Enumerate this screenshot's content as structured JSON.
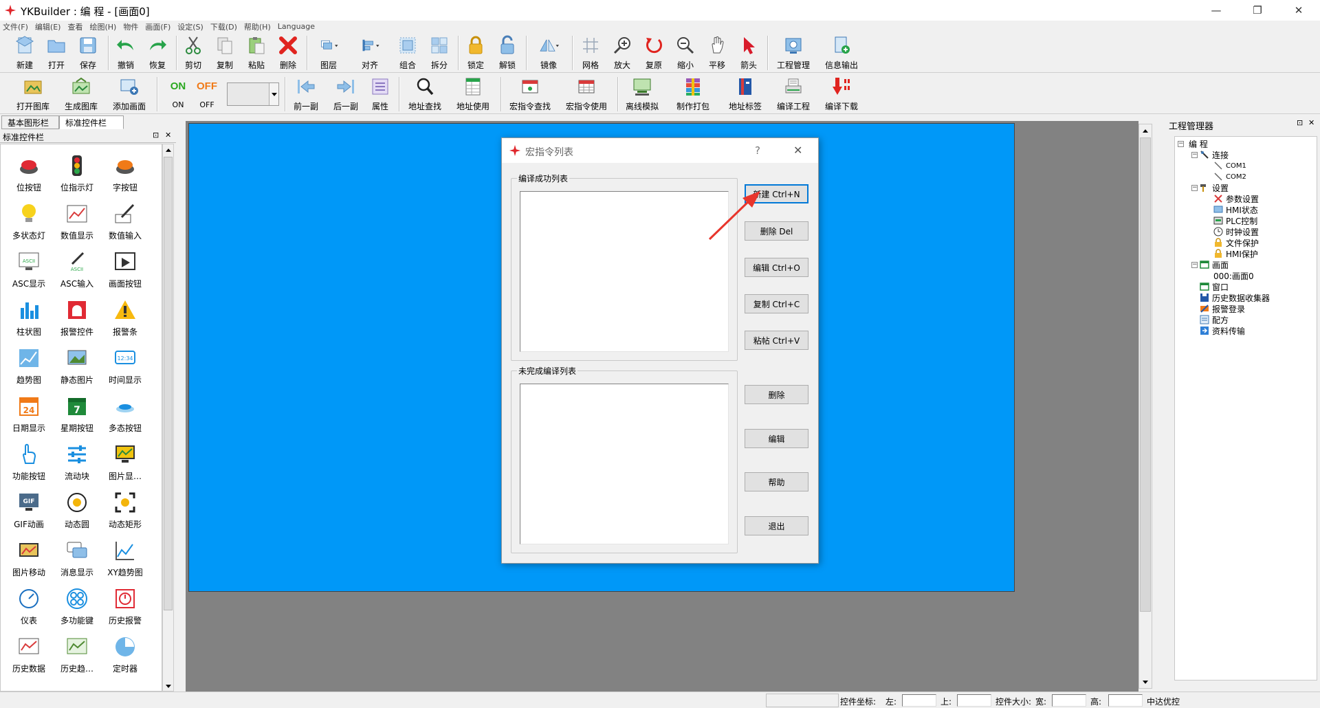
{
  "window": {
    "title": "YKBuilder : 编 程 - [画面0]",
    "buttons": {
      "minimize": "—",
      "restore": "❐",
      "close": "✕"
    }
  },
  "menu": [
    "文件(F)",
    "编辑(E)",
    "查看",
    "绘图(H)",
    "物件",
    "画面(F)",
    "设定(S)",
    "下载(D)",
    "帮助(H)",
    "Language"
  ],
  "toolbar1": [
    "新建",
    "打开",
    "保存",
    "撤销",
    "恢复",
    "剪切",
    "复制",
    "粘贴",
    "删除",
    "图层",
    "对齐",
    "组合",
    "拆分",
    "锁定",
    "解锁",
    "镜像",
    "网格",
    "放大",
    "复原",
    "缩小",
    "平移",
    "箭头",
    "工程管理",
    "信息输出"
  ],
  "toolbar2": {
    "items": [
      "打开图库",
      "生成图库",
      "添加画面",
      "ON",
      "OFF",
      "前一副",
      "后一副",
      "属性",
      "地址查找",
      "地址使用",
      "宏指令查找",
      "宏指令使用",
      "离线模拟",
      "制作打包",
      "地址标签",
      "编译工程",
      "编译下载"
    ],
    "on_glyph": "ON",
    "off_glyph": "OFF"
  },
  "left_panel": {
    "tabs": [
      "基本图形栏",
      "标准控件栏"
    ],
    "title": "标准控件栏",
    "pin_icon": "⊡",
    "close_icon": "✕",
    "controls": [
      "位按钮",
      "位指示灯",
      "字按钮",
      "多状态灯",
      "数值显示",
      "数值输入",
      "ASC显示",
      "ASC输入",
      "画面按钮",
      "柱状图",
      "报警控件",
      "报警条",
      "趋势图",
      "静态图片",
      "时间显示",
      "日期显示",
      "星期按钮",
      "多态按钮",
      "功能按钮",
      "流动块",
      "图片显…",
      "GIF动画",
      "动态圆",
      "动态矩形",
      "图片移动",
      "消息显示",
      "XY趋势图",
      "仪表",
      "多功能键",
      "历史报警",
      "历史数据",
      "历史趋…",
      "定时器"
    ],
    "icon_text": {
      "asc": "ASCII",
      "time": "12:34",
      "date": "24",
      "week": "7",
      "gif": "GIF"
    }
  },
  "dialog": {
    "title": "宏指令列表",
    "help_icon": "?",
    "close_icon": "✕",
    "group1_title": "编译成功列表",
    "group2_title": "未完成编译列表",
    "buttons": {
      "new": "新建 Ctrl+N",
      "delete_top": "删除 Del",
      "edit_top": "编辑 Ctrl+O",
      "copy": "复制 Ctrl+C",
      "paste": "粘帖 Ctrl+V",
      "delete_bottom": "删除",
      "edit_bottom": "编辑",
      "help": "帮助",
      "exit": "退出"
    }
  },
  "right_panel": {
    "title": "工程管理器",
    "pin_icon": "⊡",
    "close_icon": "✕",
    "tree": {
      "root": "编 程",
      "connect": "连接",
      "com1": "COM1",
      "com2": "COM2",
      "settings": "设置",
      "param": "参数设置",
      "hmi_status": "HMI状态",
      "plc": "PLC控制",
      "clock": "时钟设置",
      "file_protect": "文件保护",
      "hmi_protect": "HMI保护",
      "screen": "画面",
      "screen0": "000:画面0",
      "window": "窗口",
      "history": "历史数据收集器",
      "alarm": "报警登录",
      "recipe": "配方",
      "transfer": "资料传输"
    }
  },
  "statusbar": {
    "pos_label": "控件坐标:",
    "left": "左:",
    "top": "上:",
    "size_label": "控件大小:",
    "width": "宽:",
    "height": "高:",
    "mode": "中达优控"
  },
  "colors": {
    "canvas_bg": "#828282",
    "screen": "#0098f8",
    "annotation": "#e8352c"
  }
}
